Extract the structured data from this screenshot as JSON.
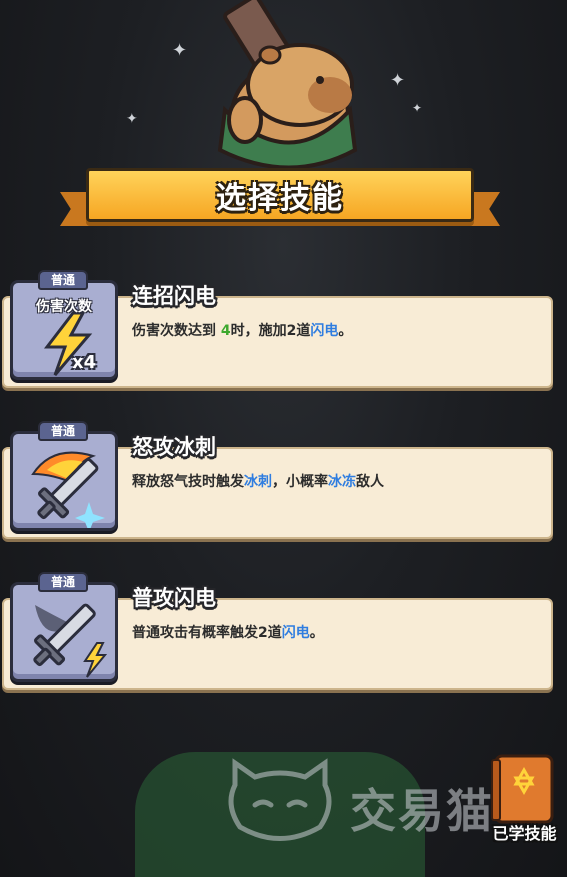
{
  "header": {
    "title": "选择技能"
  },
  "skills": [
    {
      "rarity": "普通",
      "name": "连招闪电",
      "icon_caption": "伤害次数",
      "icon_count": "x4",
      "icon": "lightning-icon",
      "desc": {
        "a": "伤害次数达到 ",
        "b": "4",
        "c": "时，施加2道",
        "d": "闪电",
        "e": "。"
      }
    },
    {
      "rarity": "普通",
      "name": "怒攻冰刺",
      "icon": "flaming-sword-icon",
      "desc": {
        "a": "释放怒气技时触发",
        "b": "冰刺",
        "c": "，小概率",
        "d": "冰冻",
        "e": "敌人"
      }
    },
    {
      "rarity": "普通",
      "name": "普攻闪电",
      "icon": "sword-lightning-icon",
      "desc": {
        "a": "普通攻击有概率触发2道",
        "b": "闪电",
        "c": "。"
      }
    }
  ],
  "footer": {
    "learned_label": "已学技能",
    "watermark": "交易猫"
  },
  "colors": {
    "highlight_green": "#3ea82e",
    "highlight_blue": "#2f7de0",
    "banner": "#f6a623",
    "icon_panel": "#a9aed1"
  }
}
